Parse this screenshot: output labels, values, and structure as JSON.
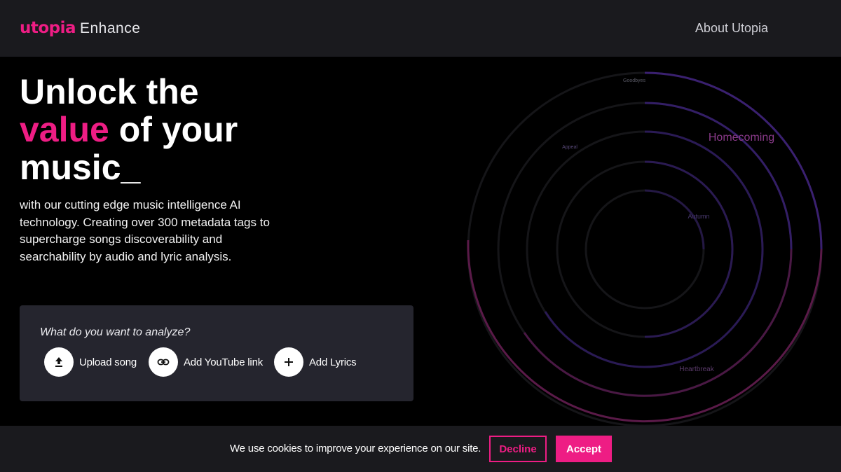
{
  "header": {
    "logo_text": "utopia",
    "product_name": "Enhance",
    "about_link": "About Utopia"
  },
  "hero": {
    "title_line1": "Unlock the",
    "title_accent": "value",
    "title_line2_rest": " of your",
    "title_line3": "music_",
    "description": "with our cutting edge music intelligence AI technology. Creating over 300 metadata tags to supercharge songs discoverability and searchability by audio and lyric analysis."
  },
  "analyze": {
    "prompt": "What do you want to analyze?",
    "options": [
      {
        "label": "Upload song",
        "icon": "upload-icon"
      },
      {
        "label": "Add YouTube link",
        "icon": "link-icon"
      },
      {
        "label": "Add Lyrics",
        "icon": "plus-icon"
      }
    ]
  },
  "visualization": {
    "labels": [
      "Goodbyes",
      "Appeal",
      "Homecoming",
      "Autumn",
      "Heartbreak"
    ]
  },
  "cookie": {
    "message": "We use cookies to improve your experience on our site.",
    "decline_label": "Decline",
    "accept_label": "Accept"
  },
  "colors": {
    "brand": "#ee1d84",
    "header_bg": "#1a1a1e",
    "card_bg": "#25252e",
    "ring_purple": "#3a2070",
    "ring_magenta": "#6a1a48"
  }
}
